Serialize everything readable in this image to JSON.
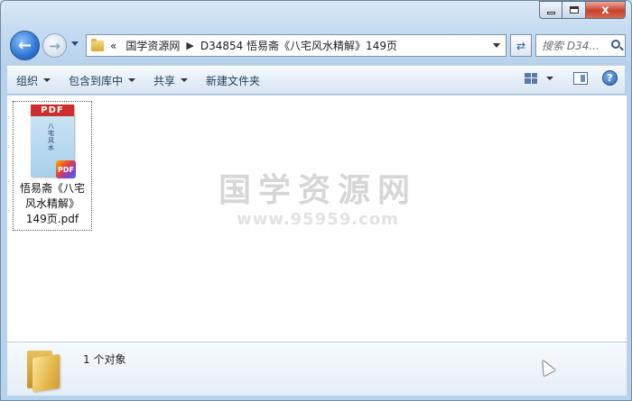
{
  "window": {
    "close_glyph": "x"
  },
  "nav": {
    "back_glyph": "←",
    "forward_glyph": "→"
  },
  "address": {
    "overflow": "«",
    "crumbs": [
      "国学资源网",
      "D34854 悟易斋《八宅风水精解》149页"
    ],
    "separator": "▶"
  },
  "search": {
    "placeholder": "搜索 D34..."
  },
  "toolbar": {
    "organize": "组织",
    "include_in_library": "包含到库中",
    "share": "共享",
    "new_folder": "新建文件夹",
    "help_glyph": "?"
  },
  "files": [
    {
      "name": "悟易斋《八宅风水精解》149页.pdf",
      "name_line1": "悟易斋《八宅",
      "name_line2": "风水精解》",
      "name_line3": "149页.pdf",
      "thumb_label": "PDF",
      "thumb_title": "八宅风水",
      "badge": "PDF"
    }
  ],
  "watermark": {
    "line1": "国学资源网",
    "line2": "www.95959.com"
  },
  "details": {
    "count_text": "1 个对象"
  }
}
